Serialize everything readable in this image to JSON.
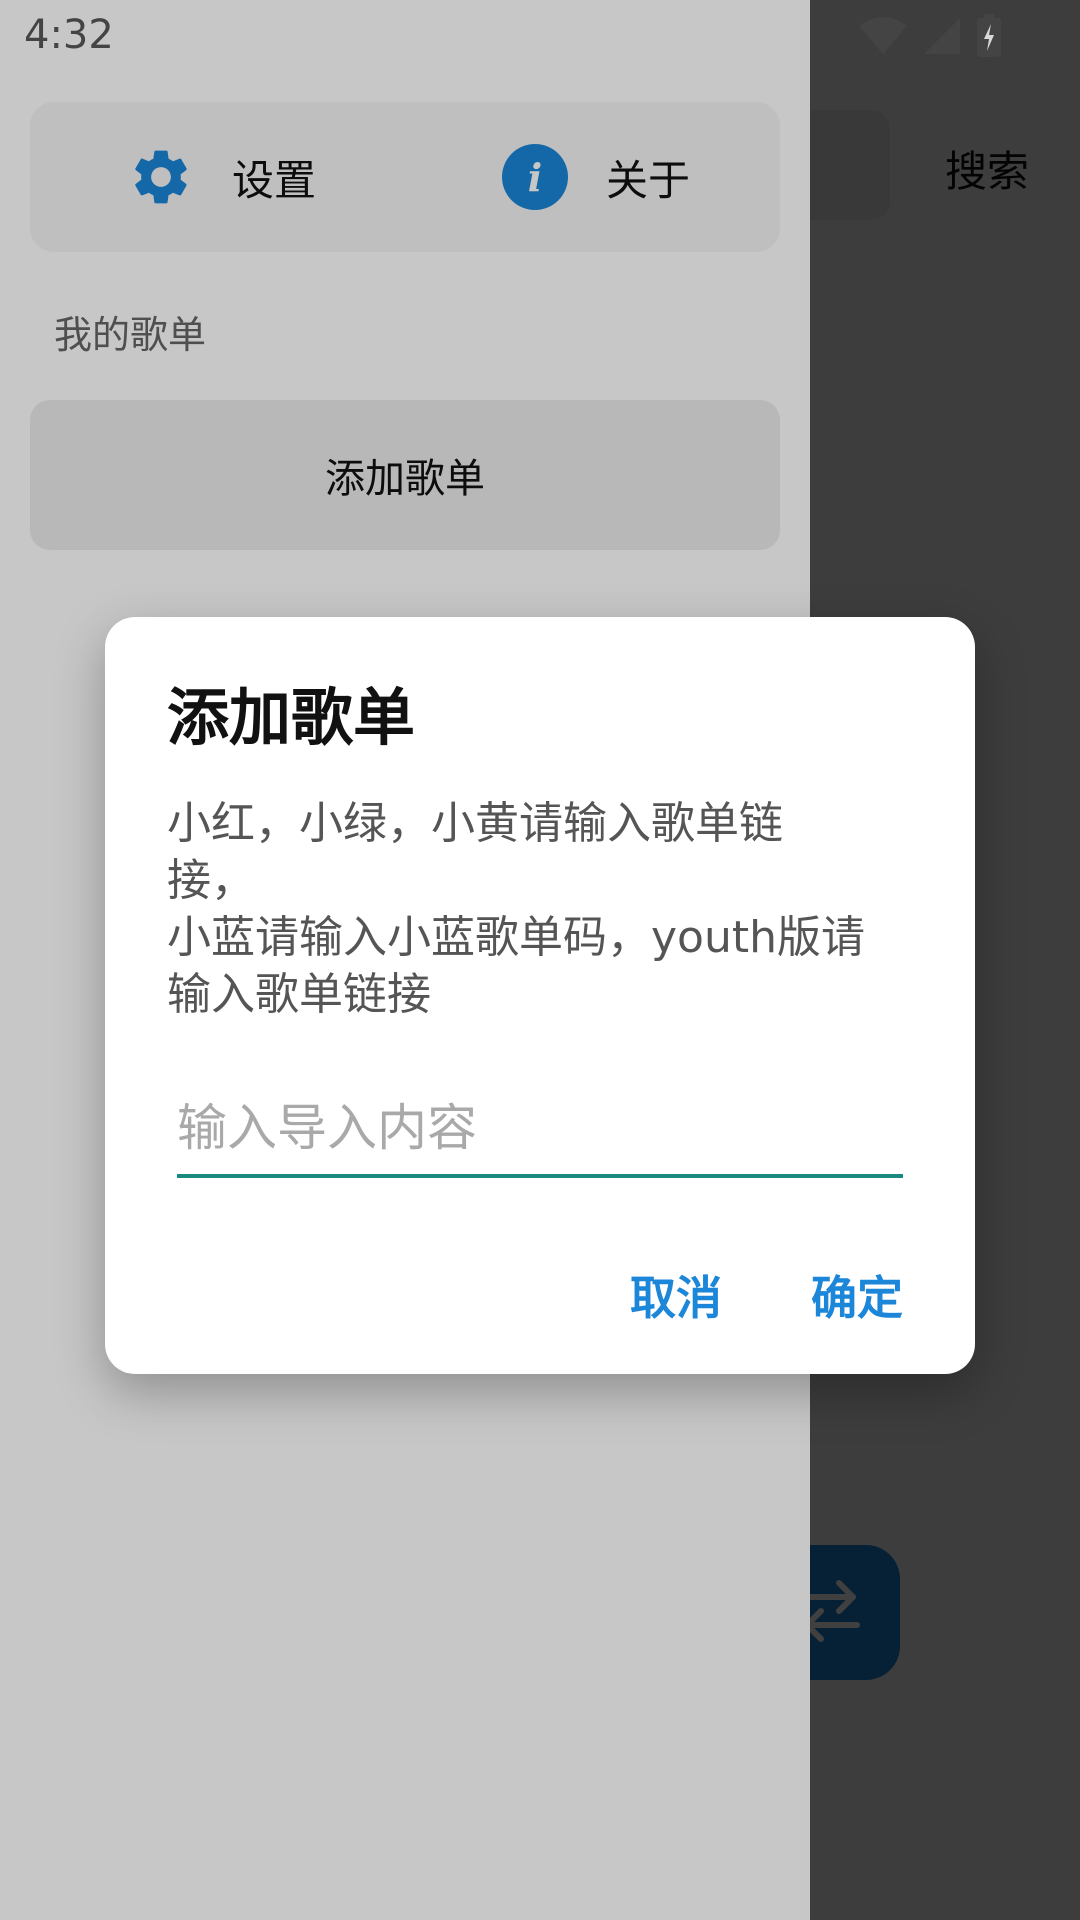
{
  "status_bar": {
    "time": "4:32",
    "icons": [
      "wifi-icon",
      "signal-icon",
      "battery-charging-icon"
    ]
  },
  "main_background": {
    "search_label": "搜索",
    "clear_icon": "clear-circle-icon",
    "fab_icon": "swap-arrows-icon"
  },
  "drawer": {
    "settings_label": "设置",
    "about_label": "关于",
    "settings_icon": "gear-icon",
    "about_icon": "info-icon",
    "about_icon_glyph": "i",
    "playlists_section_title": "我的歌单",
    "add_playlist_label": "添加歌单"
  },
  "dialog": {
    "title": "添加歌单",
    "message": "小红，小绿，小黄请输入歌单链\n接，\n小蓝请输入小蓝歌单码，youth版请\n输入歌单链接",
    "input_value": "",
    "input_placeholder": "输入导入内容",
    "cancel_label": "取消",
    "confirm_label": "确定"
  },
  "colors": {
    "accent": "#1c86d8",
    "input_underline": "#1a8a80",
    "scrim": "#000000"
  }
}
